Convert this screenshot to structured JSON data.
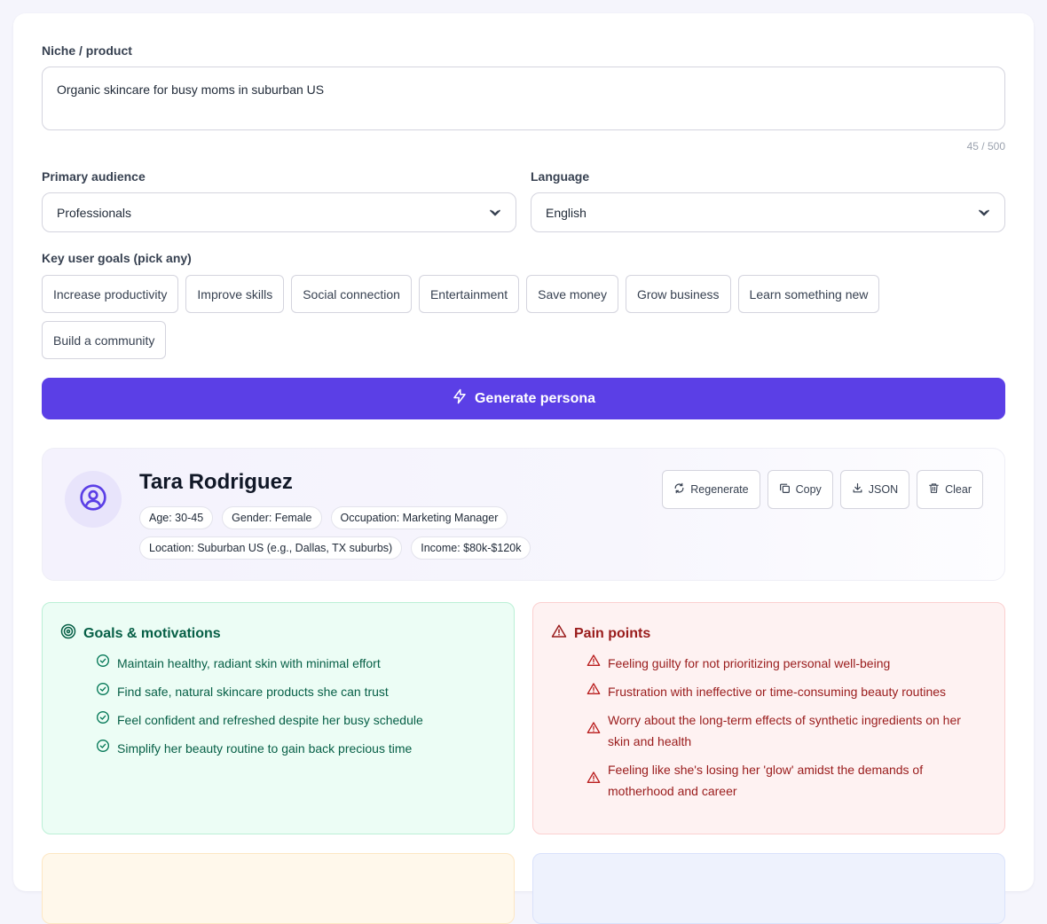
{
  "form": {
    "niche_label": "Niche / product",
    "niche_value": "Organic skincare for busy moms in suburban US",
    "char_count": "45 / 500",
    "audience_label": "Primary audience",
    "audience_value": "Professionals",
    "language_label": "Language",
    "language_value": "English",
    "goals_label": "Key user goals (pick any)",
    "goal_chips": [
      "Increase productivity",
      "Improve skills",
      "Social connection",
      "Entertainment",
      "Save money",
      "Grow business",
      "Learn something new",
      "Build a community"
    ],
    "generate_label": "Generate persona"
  },
  "persona": {
    "name": "Tara Rodriguez",
    "tags": [
      "Age: 30-45",
      "Gender: Female",
      "Occupation: Marketing Manager",
      "Location: Suburban US (e.g., Dallas, TX suburbs)",
      "Income: $80k-$120k"
    ],
    "actions": {
      "regenerate": "Regenerate",
      "copy": "Copy",
      "json": "JSON",
      "clear": "Clear"
    }
  },
  "goals_panel": {
    "title": "Goals & motivations",
    "items": [
      "Maintain healthy, radiant skin with minimal effort",
      "Find safe, natural skincare products she can trust",
      "Feel confident and refreshed despite her busy schedule",
      "Simplify her beauty routine to gain back precious time"
    ]
  },
  "pain_panel": {
    "title": "Pain points",
    "items": [
      "Feeling guilty for not prioritizing personal well-being",
      "Frustration with ineffective or time-consuming beauty routines",
      "Worry about the long-term effects of synthetic ingredients on her skin and health",
      "Feeling like she's losing her 'glow' amidst the demands of motherhood and career"
    ]
  },
  "colors": {
    "accent": "#5b3fe6",
    "goals_bg": "#ecfdf5",
    "goals_text": "#065f46",
    "pain_bg": "#fef2f2",
    "pain_text": "#991b1b"
  }
}
